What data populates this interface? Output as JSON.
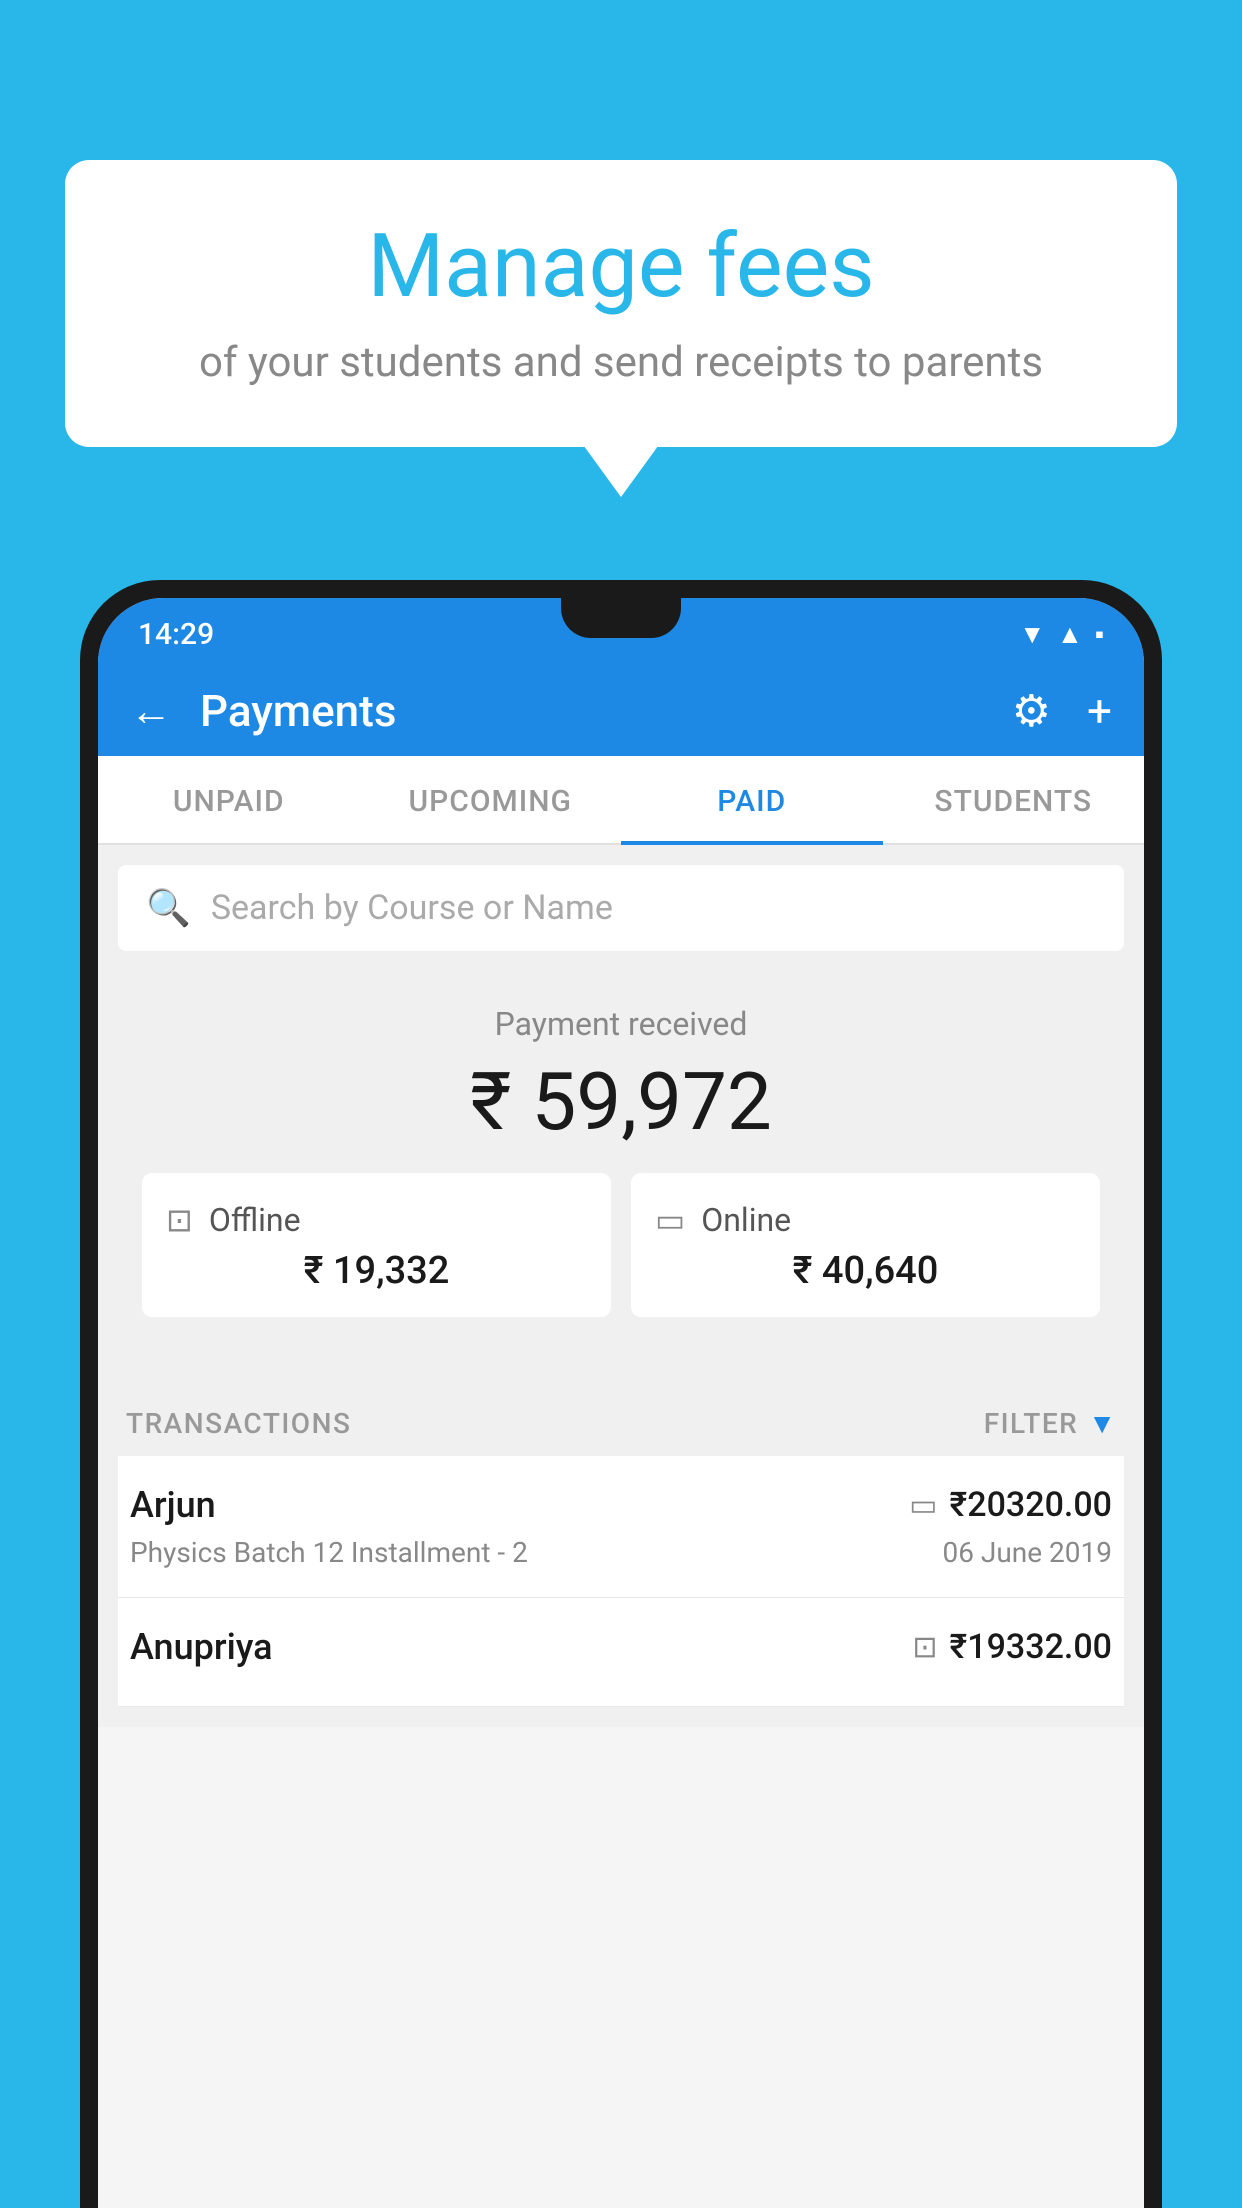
{
  "background_color": "#29b6e8",
  "speech_bubble": {
    "title": "Manage fees",
    "subtitle": "of your students and send receipts to parents"
  },
  "status_bar": {
    "time": "14:29",
    "wifi": "▲",
    "signal": "▲",
    "battery": "▪"
  },
  "app_bar": {
    "title": "Payments",
    "back_label": "←",
    "gear_label": "⚙",
    "plus_label": "+"
  },
  "tabs": [
    {
      "label": "UNPAID",
      "active": false
    },
    {
      "label": "UPCOMING",
      "active": false
    },
    {
      "label": "PAID",
      "active": true
    },
    {
      "label": "STUDENTS",
      "active": false
    }
  ],
  "search": {
    "placeholder": "Search by Course or Name"
  },
  "payment_summary": {
    "received_label": "Payment received",
    "total_amount": "₹ 59,972",
    "offline_label": "Offline",
    "offline_amount": "₹ 19,332",
    "online_label": "Online",
    "online_amount": "₹ 40,640"
  },
  "transactions_section": {
    "label": "TRANSACTIONS",
    "filter_label": "FILTER"
  },
  "transactions": [
    {
      "name": "Arjun",
      "course": "Physics Batch 12 Installment - 2",
      "amount": "₹20320.00",
      "date": "06 June 2019",
      "payment_type": "online"
    },
    {
      "name": "Anupriya",
      "course": "",
      "amount": "₹19332.00",
      "date": "",
      "payment_type": "offline"
    }
  ]
}
